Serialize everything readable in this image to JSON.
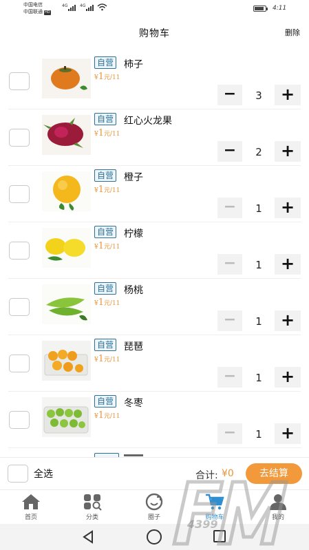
{
  "status_bar": {
    "carrier1": "中国电信",
    "carrier2": "中国联通",
    "hd": "HD",
    "network": "4G",
    "time": "4:11"
  },
  "header": {
    "title": "购物车",
    "delete_label": "删除"
  },
  "cart": {
    "items": [
      {
        "tag": "自营",
        "name": "柿子",
        "currency": "¥",
        "price": "1",
        "unit": "元/1",
        "unit_suffix": "1",
        "qty": "3",
        "minus": "−",
        "plus": "+",
        "minus_disabled": false
      },
      {
        "tag": "自营",
        "name": "红心火龙果",
        "currency": "¥",
        "price": "1",
        "unit": "元/1",
        "unit_suffix": "1",
        "qty": "2",
        "minus": "−",
        "plus": "+",
        "minus_disabled": false
      },
      {
        "tag": "自营",
        "name": "橙子",
        "currency": "¥",
        "price": "1",
        "unit": "元/1",
        "unit_suffix": "1",
        "qty": "1",
        "minus": "−",
        "plus": "+",
        "minus_disabled": true
      },
      {
        "tag": "自营",
        "name": "柠檬",
        "currency": "¥",
        "price": "1",
        "unit": "元/1",
        "unit_suffix": "1",
        "qty": "1",
        "minus": "−",
        "plus": "+",
        "minus_disabled": true
      },
      {
        "tag": "自营",
        "name": "杨桃",
        "currency": "¥",
        "price": "1",
        "unit": "元/1",
        "unit_suffix": "1",
        "qty": "1",
        "minus": "−",
        "plus": "+",
        "minus_disabled": true
      },
      {
        "tag": "自营",
        "name": "琵琶",
        "currency": "¥",
        "price": "1",
        "unit": "元/1",
        "unit_suffix": "1",
        "qty": "1",
        "minus": "−",
        "plus": "+",
        "minus_disabled": true
      },
      {
        "tag": "自营",
        "name": "冬枣",
        "currency": "¥",
        "price": "1",
        "unit": "元/1",
        "unit_suffix": "1",
        "qty": "1",
        "minus": "−",
        "plus": "+",
        "minus_disabled": true
      }
    ]
  },
  "checkout": {
    "select_all": "全选",
    "total_label": "合计:",
    "total_value": "¥0",
    "button": "去结算"
  },
  "tabs": [
    {
      "label": "首页",
      "icon": "home-icon"
    },
    {
      "label": "分类",
      "icon": "category-icon"
    },
    {
      "label": "圈子",
      "icon": "circle-icon"
    },
    {
      "label": "购物车",
      "icon": "cart-icon",
      "active": true
    },
    {
      "label": "我的",
      "icon": "profile-icon"
    }
  ],
  "watermark": "4399",
  "colors": {
    "accent": "#f29a3b",
    "price": "#e8953a",
    "tag": "#2a6f95",
    "active_tab": "#2f8ed0"
  }
}
